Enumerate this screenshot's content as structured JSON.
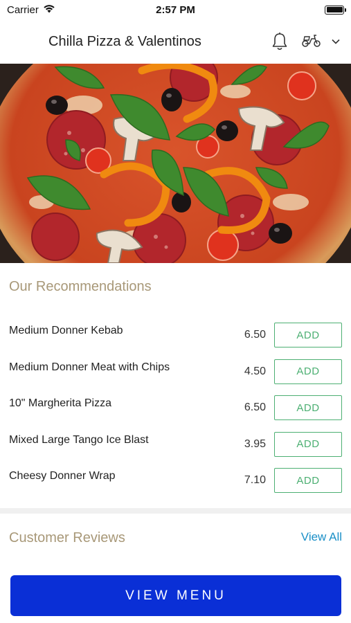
{
  "status_bar": {
    "carrier": "Carrier",
    "time": "2:57 PM",
    "battery_level": 1.0
  },
  "header": {
    "title": "Chilla Pizza & Valentinos",
    "icons": [
      "menu-icon",
      "bell-icon",
      "scooter-icon",
      "chevron-down-icon"
    ]
  },
  "recommendations": {
    "title": "Our Recommendations",
    "items": [
      {
        "name": "Medium Donner Kebab",
        "price": "6.50",
        "button": "ADD"
      },
      {
        "name": "Medium Donner Meat with Chips",
        "price": "4.50",
        "button": "ADD"
      },
      {
        "name": "10\" Margherita Pizza",
        "price": "6.50",
        "button": "ADD"
      },
      {
        "name": "Mixed Large Tango Ice Blast",
        "price": "3.95",
        "button": "ADD"
      },
      {
        "name": "Cheesy Donner Wrap",
        "price": "7.10",
        "button": "ADD"
      }
    ]
  },
  "reviews": {
    "title": "Customer Reviews",
    "view_all": "View All"
  },
  "cta": {
    "label": "VIEW MENU"
  },
  "colors": {
    "accent_green": "#4caf72",
    "section_title": "#a89878",
    "link_blue": "#1a8fc7",
    "cta_blue": "#0a2fd6"
  }
}
